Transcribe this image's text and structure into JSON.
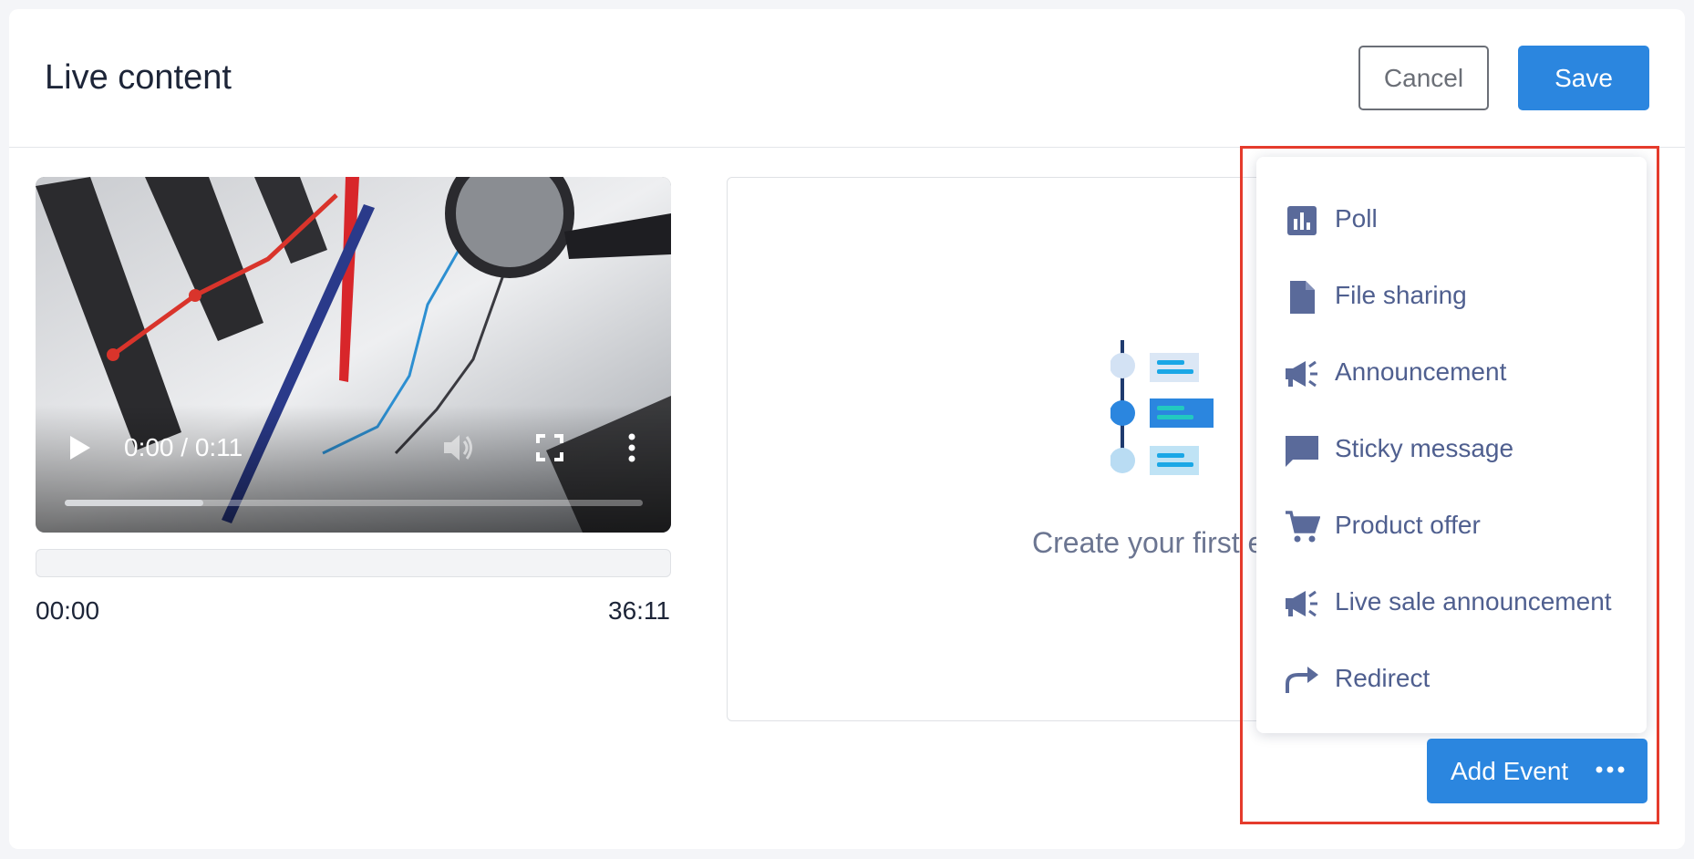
{
  "header": {
    "title": "Live content",
    "cancel_label": "Cancel",
    "save_label": "Save"
  },
  "player": {
    "time": "0:00 / 0:11",
    "progress": 0.24,
    "icons": [
      "play-icon",
      "volume-icon",
      "fullscreen-icon",
      "more-vert-icon"
    ]
  },
  "timeline": {
    "start": "00:00",
    "end": "36:11"
  },
  "events_panel": {
    "empty_text": "Create your first e"
  },
  "event_menu": {
    "items": [
      {
        "label": "Poll",
        "icon": "poll-icon"
      },
      {
        "label": "File sharing",
        "icon": "file-icon"
      },
      {
        "label": "Announcement",
        "icon": "megaphone-icon"
      },
      {
        "label": "Sticky message",
        "icon": "message-icon"
      },
      {
        "label": "Product offer",
        "icon": "cart-icon"
      },
      {
        "label": "Live sale announcement",
        "icon": "megaphone-icon"
      },
      {
        "label": "Redirect",
        "icon": "redirect-icon"
      }
    ]
  },
  "add_event": {
    "label": "Add Event",
    "icon": "more-horiz-icon"
  },
  "colors": {
    "primary": "#2b86df",
    "menu_text": "#4f5f8f",
    "menu_icon": "#5a6a9a",
    "highlight": "#e53b2c"
  }
}
